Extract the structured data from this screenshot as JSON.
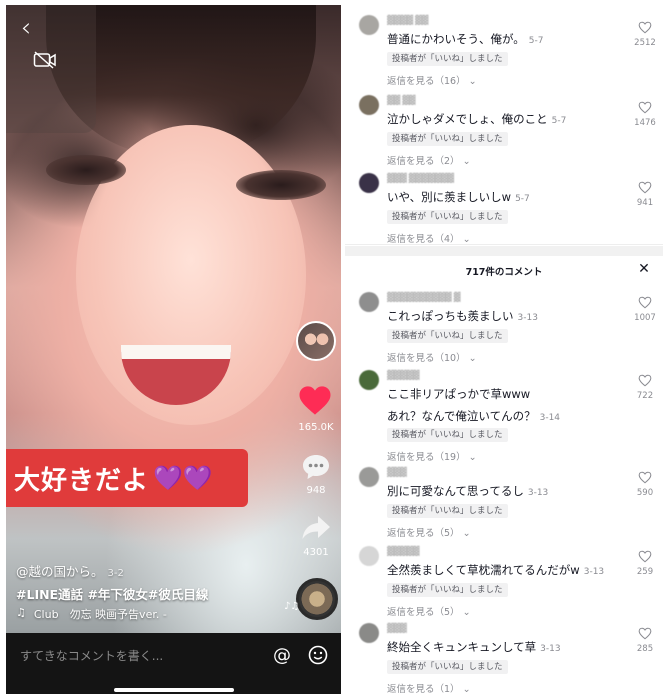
{
  "video": {
    "caption": "大好きだよ",
    "caption_hearts": "💜💜",
    "author": "@越の国から。",
    "date": "3-2",
    "hashtags": "#LINE通話 #年下彼女#彼氏目線",
    "music_note": "♫",
    "music_title": "Club　勿忘 映画予告ver. -",
    "like_count": "165.0K",
    "comment_count": "948",
    "share_count": "4301",
    "comment_placeholder": "すてきなコメントを書く...",
    "at_symbol": "@",
    "back_glyph": "‹",
    "music_notes_glyph": "♪♫"
  },
  "comments_top": [
    {
      "user": "▓▓▓▓ ▓▓",
      "text": "普通にかわいそう、俺が。",
      "date": "5-7",
      "badge": "投稿者が「いいね」しました",
      "replies": "返信を見る（16）",
      "likes": "2512"
    },
    {
      "user": "▓▓ ▓▓",
      "text": "泣かしゃダメでしょ、俺のこと",
      "date": "5-7",
      "badge": "投稿者が「いいね」しました",
      "replies": "返信を見る（2）",
      "likes": "1476"
    },
    {
      "user": "▓▓▓ ▓▓▓▓▓▓▓",
      "text": "いや、別に羨ましいしw",
      "date": "5-7",
      "badge": "投稿者が「いいね」しました",
      "replies": "返信を見る（4）",
      "likes": "941"
    }
  ],
  "panel": {
    "title": "717件のコメント",
    "close": "✕"
  },
  "comments_bottom": [
    {
      "user": "▓▓▓▓▓▓▓▓▓▓ ▓",
      "text": "これっぽっちも羨ましい",
      "text2": "",
      "date": "3-13",
      "badge": "投稿者が「いいね」しました",
      "replies": "返信を見る（10）",
      "likes": "1007"
    },
    {
      "user": "▓▓▓▓▓",
      "text": "ここ非リアぱっかで草www",
      "text2": "あれ？なんで俺泣いてんの？",
      "date": "3-14",
      "badge": "投稿者が「いいね」しました",
      "replies": "返信を見る（19）",
      "likes": "722"
    },
    {
      "user": "▓▓▓",
      "text": "別に可愛なんて思ってるし",
      "text2": "",
      "date": "3-13",
      "badge": "投稿者が「いいね」しました",
      "replies": "返信を見る（5）",
      "likes": "590"
    },
    {
      "user": "▓▓▓▓▓",
      "text": "全然羨ましくて草枕濡れてるんだがw",
      "text2": "",
      "date": "3-13",
      "badge": "投稿者が「いいね」しました",
      "replies": "返信を見る（5）",
      "likes": "259"
    },
    {
      "user": "▓▓▓",
      "text": "終始全くキュンキュンして草",
      "text2": "",
      "date": "3-13",
      "badge": "投稿者が「いいね」しました",
      "replies": "返信を見る（1）",
      "likes": "285"
    }
  ],
  "colors": {
    "like_red": "#fe2c55",
    "caption_bg": "#e03b3b",
    "text_primary": "#161823",
    "text_secondary": "#8a8b91"
  }
}
